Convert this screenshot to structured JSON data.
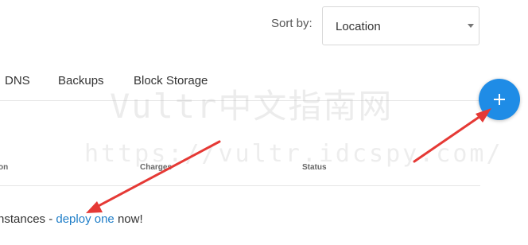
{
  "sort": {
    "label": "Sort by:",
    "selected": "Location"
  },
  "tabs": [
    {
      "label": "DNS"
    },
    {
      "label": "Backups"
    },
    {
      "label": "Block Storage"
    }
  ],
  "add_button": {
    "icon": "plus-icon",
    "color": "#1f8ce6"
  },
  "table": {
    "columns": [
      "on",
      "Charges",
      "Status"
    ]
  },
  "empty_state": {
    "prefix": "nstances - ",
    "link": "deploy one",
    "suffix": " now!"
  },
  "watermark": {
    "line1": "Vultr中文指南网",
    "line2": "https://vultr.idcspy.com/"
  },
  "annotation": {
    "arrow_color": "#e53935"
  }
}
